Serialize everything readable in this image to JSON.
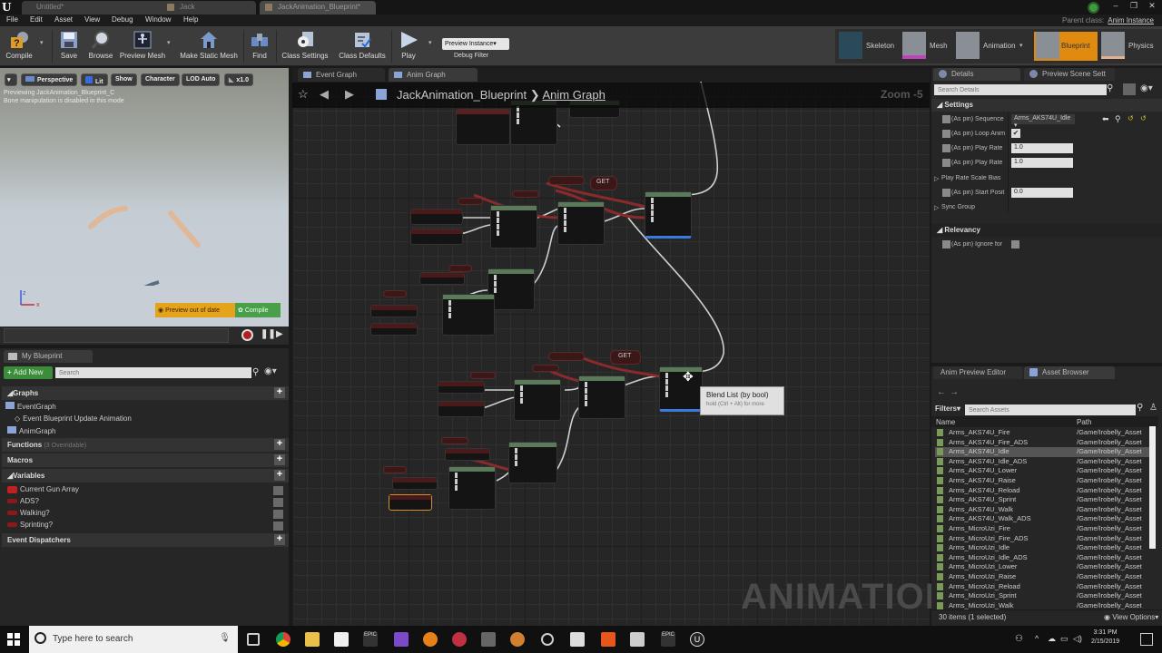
{
  "window": {
    "tabs": [
      {
        "label": "Untitled*",
        "active": false
      },
      {
        "label": "Jack",
        "active": false
      },
      {
        "label": "JackAnimation_Blueprint*",
        "active": true
      }
    ],
    "controls": {
      "minimize": "–",
      "maximize": "❐",
      "close": "✕"
    },
    "parent_class_label": "Parent class:",
    "parent_class_value": "Anim Instance"
  },
  "menu": [
    "File",
    "Edit",
    "Asset",
    "View",
    "Debug",
    "Window",
    "Help"
  ],
  "toolbar": {
    "buttons": [
      {
        "label": "Compile",
        "icon": "compile-icon"
      },
      {
        "label": "Save",
        "icon": "save-icon"
      },
      {
        "label": "Browse",
        "icon": "browse-icon"
      },
      {
        "label": "Preview Mesh",
        "icon": "preview-mesh-icon"
      },
      {
        "label": "Make Static Mesh",
        "icon": "make-static-mesh-icon"
      },
      {
        "label": "Find",
        "icon": "find-icon"
      },
      {
        "label": "Class Settings",
        "icon": "class-settings-icon"
      },
      {
        "label": "Class Defaults",
        "icon": "class-defaults-icon"
      },
      {
        "label": "Play",
        "icon": "play-icon"
      }
    ],
    "debug_select": "Preview Instance▾",
    "debug_filter_label": "Debug Filter",
    "modes": [
      {
        "label": "Skeleton",
        "active": false
      },
      {
        "label": "Mesh",
        "active": false
      },
      {
        "label": "Animation",
        "active": false
      },
      {
        "label": "Blueprint",
        "active": true
      },
      {
        "label": "Physics",
        "active": false
      }
    ]
  },
  "viewport": {
    "buttons": [
      "▾",
      "Perspective",
      "Lit",
      "Show",
      "Character",
      "LOD Auto",
      "x1.0"
    ],
    "info_line1": "Previewing JackAnimation_Blueprint_C",
    "info_line2": "Bone manipulation is disabled in this mode",
    "preview_warning": "Preview out of date",
    "compile_label": "Compile",
    "axis_x": "x",
    "axis_z": "z"
  },
  "my_blueprint": {
    "tab_label": "My Blueprint",
    "add_new_label": "Add New",
    "search_placeholder": "Search",
    "sections": {
      "graphs": "Graphs",
      "functions": "Functions",
      "functions_note": "(3 Overridable)",
      "macros": "Macros",
      "variables": "Variables",
      "dispatchers": "Event Dispatchers"
    },
    "graph_items": [
      "EventGraph",
      "Event Blueprint Update Animation",
      "AnimGraph"
    ],
    "variables": [
      "Current Gun Array",
      "ADS?",
      "Walking?",
      "Sprinting?"
    ]
  },
  "graph": {
    "tabs": [
      {
        "label": "Event Graph",
        "active": false
      },
      {
        "label": "Anim Graph",
        "active": true
      }
    ],
    "breadcrumb_root": "JackAnimation_Blueprint",
    "breadcrumb_sep": "❯",
    "breadcrumb_leaf": "Anim Graph",
    "zoom_label": "Zoom -5",
    "watermark": "ANIMATION",
    "tooltip_title": "Blend List (by bool)",
    "tooltip_hint": "hold (Ctrl + Alt) for more",
    "get_label": "GET"
  },
  "details": {
    "tabs": [
      "Details",
      "Preview Scene Sett"
    ],
    "search_placeholder": "Search Details",
    "settings_header": "Settings",
    "rows": [
      {
        "label": "(As pin) Sequence",
        "value": "Arms_AKS74U_Idle"
      },
      {
        "label": "(As pin) Loop Anim",
        "value": "✔"
      },
      {
        "label": "(As pin) Play Rate",
        "value": "1.0"
      },
      {
        "label": "(As pin) Play Rate",
        "value": "1.0"
      },
      {
        "label": "Play Rate Scale Bias",
        "value": ""
      },
      {
        "label": "(As pin) Start Posit",
        "value": "0.0"
      },
      {
        "label": "Sync Group",
        "value": ""
      }
    ],
    "relevancy_header": "Relevancy",
    "relevancy_row": "(As pin) Ignore for"
  },
  "asset_browser": {
    "tabs": [
      "Anim Preview Editor",
      "Asset Browser"
    ],
    "filters_label": "Filters▾",
    "search_placeholder": "Search Assets",
    "col_name": "Name",
    "col_path": "Path",
    "rows": [
      {
        "name": "Arms_AKS74U_Fire",
        "path": "/Game/Irobelly_Asset",
        "selected": false
      },
      {
        "name": "Arms_AKS74U_Fire_ADS",
        "path": "/Game/Irobelly_Asset",
        "selected": false
      },
      {
        "name": "Arms_AKS74U_Idle",
        "path": "/Game/Irobelly_Asset",
        "selected": true
      },
      {
        "name": "Arms_AKS74U_Idle_ADS",
        "path": "/Game/Irobelly_Asset",
        "selected": false
      },
      {
        "name": "Arms_AKS74U_Lower",
        "path": "/Game/Irobelly_Asset",
        "selected": false
      },
      {
        "name": "Arms_AKS74U_Raise",
        "path": "/Game/Irobelly_Asset",
        "selected": false
      },
      {
        "name": "Arms_AKS74U_Reload",
        "path": "/Game/Irobelly_Asset",
        "selected": false
      },
      {
        "name": "Arms_AKS74U_Sprint",
        "path": "/Game/Irobelly_Asset",
        "selected": false
      },
      {
        "name": "Arms_AKS74U_Walk",
        "path": "/Game/Irobelly_Asset",
        "selected": false
      },
      {
        "name": "Arms_AKS74U_Walk_ADS",
        "path": "/Game/Irobelly_Asset",
        "selected": false
      },
      {
        "name": "Arms_MicroUzi_Fire",
        "path": "/Game/Irobelly_Asset",
        "selected": false
      },
      {
        "name": "Arms_MicroUzi_Fire_ADS",
        "path": "/Game/Irobelly_Asset",
        "selected": false
      },
      {
        "name": "Arms_MicroUzi_Idle",
        "path": "/Game/Irobelly_Asset",
        "selected": false
      },
      {
        "name": "Arms_MicroUzi_Idle_ADS",
        "path": "/Game/Irobelly_Asset",
        "selected": false
      },
      {
        "name": "Arms_MicroUzi_Lower",
        "path": "/Game/Irobelly_Asset",
        "selected": false
      },
      {
        "name": "Arms_MicroUzi_Raise",
        "path": "/Game/Irobelly_Asset",
        "selected": false
      },
      {
        "name": "Arms_MicroUzi_Reload",
        "path": "/Game/Irobelly_Asset",
        "selected": false
      },
      {
        "name": "Arms_MicroUzi_Sprint",
        "path": "/Game/Irobelly_Asset",
        "selected": false
      },
      {
        "name": "Arms_MicroUzi_Walk",
        "path": "/Game/Irobelly_Asset",
        "selected": false
      }
    ],
    "status": "30 items (1 selected)",
    "view_options": "View Options▾"
  },
  "taskbar": {
    "search_placeholder": "Type here to search",
    "time": "3:31 PM",
    "date": "2/15/2019"
  }
}
